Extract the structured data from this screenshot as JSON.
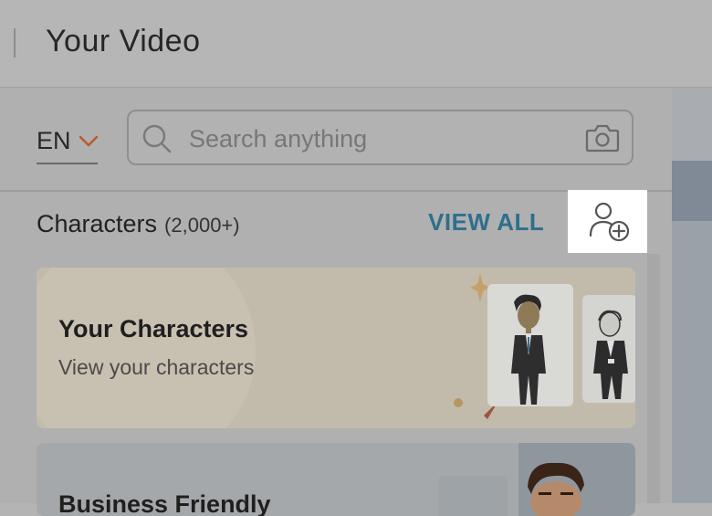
{
  "header": {
    "title": "Your Video"
  },
  "search_row": {
    "language": "EN",
    "search_placeholder": "Search anything"
  },
  "characters": {
    "label": "Characters",
    "count": "(2,000+)",
    "view_all": "VIEW ALL"
  },
  "cards": [
    {
      "title": "Your Characters",
      "subtitle": "View your characters"
    },
    {
      "title": "Business Friendly"
    }
  ],
  "colors": {
    "accent": "#2e6f8c",
    "chevron": "#c0592b",
    "card1_bg": "#c2bbac",
    "card2_bg": "#a5a8ab"
  },
  "icons": [
    "chevron-down-icon",
    "search-icon",
    "camera-icon",
    "add-user-icon"
  ]
}
